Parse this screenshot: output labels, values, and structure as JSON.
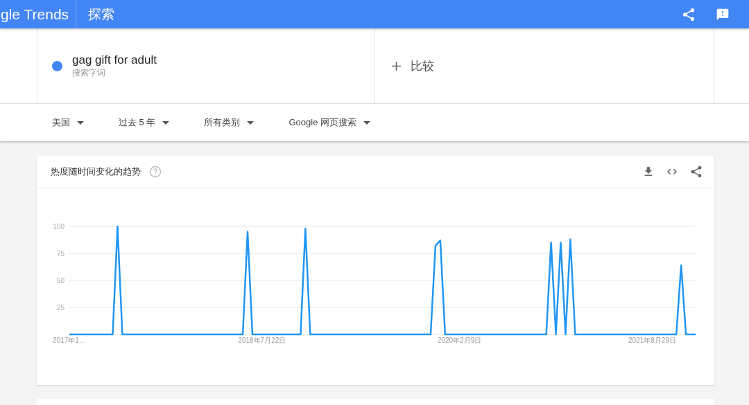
{
  "header": {
    "logo": "gle Trends",
    "title": "探索"
  },
  "search_term": {
    "term": "gag gift for adult",
    "subtitle": "搜索字词",
    "color": "#4285f4"
  },
  "compare": {
    "label": "比较"
  },
  "filters": [
    {
      "label": "美国"
    },
    {
      "label": "过去 5 年"
    },
    {
      "label": "所有类别"
    },
    {
      "label": "Google 网页搜索"
    }
  ],
  "trend_card": {
    "title": "热度随时间变化的趋势",
    "chart_data": {
      "type": "line",
      "categories": [
        "2017年1…",
        null,
        null,
        null,
        null,
        null,
        null,
        null,
        null,
        null,
        null,
        null,
        null,
        null,
        null,
        null,
        null,
        null,
        null,
        null,
        null,
        null,
        null,
        null,
        null,
        null,
        null,
        null,
        null,
        null,
        null,
        null,
        null,
        null,
        null,
        null,
        null,
        null,
        null,
        null,
        "2018年7月22日",
        null,
        null,
        null,
        null,
        null,
        null,
        null,
        null,
        null,
        null,
        null,
        null,
        null,
        null,
        null,
        null,
        null,
        null,
        null,
        null,
        null,
        null,
        null,
        null,
        null,
        null,
        null,
        null,
        null,
        null,
        null,
        null,
        null,
        null,
        null,
        null,
        null,
        null,
        null,
        null,
        "2020年2月9日",
        null,
        null,
        null,
        null,
        null,
        null,
        null,
        null,
        null,
        null,
        null,
        null,
        null,
        null,
        null,
        null,
        null,
        null,
        null,
        null,
        null,
        null,
        null,
        null,
        null,
        null,
        null,
        null,
        null,
        null,
        null,
        null,
        null,
        null,
        null,
        null,
        null,
        null,
        null,
        "2021年8月29日",
        null,
        null,
        null,
        null,
        null,
        null,
        null,
        null,
        null
      ],
      "series": [
        {
          "color": "#2196f3",
          "values": [
            0,
            0,
            0,
            0,
            0,
            0,
            0,
            0,
            0,
            0,
            100,
            0,
            0,
            0,
            0,
            0,
            0,
            0,
            0,
            0,
            0,
            0,
            0,
            0,
            0,
            0,
            0,
            0,
            0,
            0,
            0,
            0,
            0,
            0,
            0,
            0,
            0,
            95,
            0,
            0,
            0,
            0,
            0,
            0,
            0,
            0,
            0,
            0,
            0,
            98,
            0,
            0,
            0,
            0,
            0,
            0,
            0,
            0,
            0,
            0,
            0,
            0,
            0,
            0,
            0,
            0,
            0,
            0,
            0,
            0,
            0,
            0,
            0,
            0,
            0,
            0,
            82,
            87,
            0,
            0,
            0,
            0,
            0,
            0,
            0,
            0,
            0,
            0,
            0,
            0,
            0,
            0,
            0,
            0,
            0,
            0,
            0,
            0,
            0,
            0,
            85,
            0,
            85,
            0,
            88,
            0,
            0,
            0,
            0,
            0,
            0,
            0,
            0,
            0,
            0,
            0,
            0,
            0,
            0,
            0,
            0,
            0,
            0,
            0,
            0,
            0,
            0,
            64,
            0,
            0,
            0
          ]
        }
      ],
      "grid": true,
      "ylim": [
        0,
        100
      ],
      "yticks": [
        25,
        50,
        75,
        100
      ]
    }
  }
}
